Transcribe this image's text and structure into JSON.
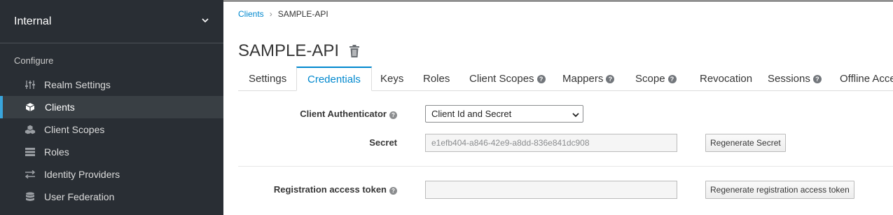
{
  "sidebar": {
    "realm": "Internal",
    "section_label": "Configure",
    "items": [
      {
        "label": "Realm Settings",
        "icon": "sliders-icon"
      },
      {
        "label": "Clients",
        "icon": "cube-icon",
        "active": true
      },
      {
        "label": "Client Scopes",
        "icon": "cubes-icon"
      },
      {
        "label": "Roles",
        "icon": "list-icon"
      },
      {
        "label": "Identity Providers",
        "icon": "exchange-icon"
      },
      {
        "label": "User Federation",
        "icon": "database-icon"
      }
    ]
  },
  "breadcrumb": {
    "parent": "Clients",
    "current": "SAMPLE-API"
  },
  "page": {
    "title": "SAMPLE-API"
  },
  "tabs": [
    {
      "label": "Settings"
    },
    {
      "label": "Credentials",
      "active": true
    },
    {
      "label": "Keys"
    },
    {
      "label": "Roles"
    },
    {
      "label": "Client Scopes",
      "help": true
    },
    {
      "label": "Mappers",
      "help": true
    },
    {
      "label": "Scope",
      "help": true
    },
    {
      "label": "Revocation"
    },
    {
      "label": "Sessions",
      "help": true
    },
    {
      "label": "Offline Acce"
    }
  ],
  "form": {
    "authenticator_label": "Client Authenticator",
    "authenticator_value": "Client Id and Secret",
    "secret_label": "Secret",
    "secret_value": "e1efb404-a846-42e9-a8dd-836e841dc908",
    "regenerate_secret": "Regenerate Secret",
    "rat_label": "Registration access token",
    "rat_value": "",
    "regenerate_rat": "Regenerate registration access token"
  },
  "colors": {
    "accent": "#0088ce",
    "sidebar_bg": "#292e34",
    "active_marker": "#39a5dc"
  }
}
